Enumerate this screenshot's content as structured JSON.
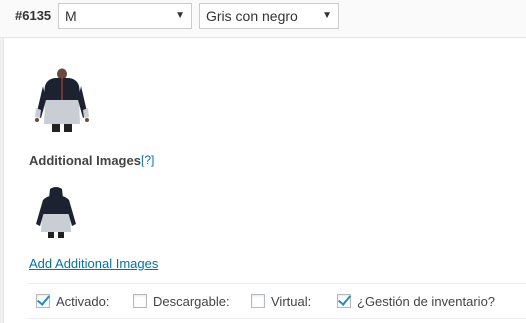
{
  "variation": {
    "id": "#6135",
    "size_select": {
      "value": "M"
    },
    "color_select": {
      "value": "Gris con negro"
    }
  },
  "images": {
    "main_alt": "jacket front image",
    "additional_title": "Additional Images",
    "help_link": "[?]",
    "add_link": "Add Additional Images"
  },
  "options": [
    {
      "label": "Activado:",
      "checked": true
    },
    {
      "label": "Descargable:",
      "checked": false
    },
    {
      "label": "Virtual:",
      "checked": false
    },
    {
      "label": "¿Gestión de inventario?",
      "checked": true
    }
  ],
  "colors": {
    "link": "#0073aa",
    "checkmark": "#1e8cbe"
  }
}
